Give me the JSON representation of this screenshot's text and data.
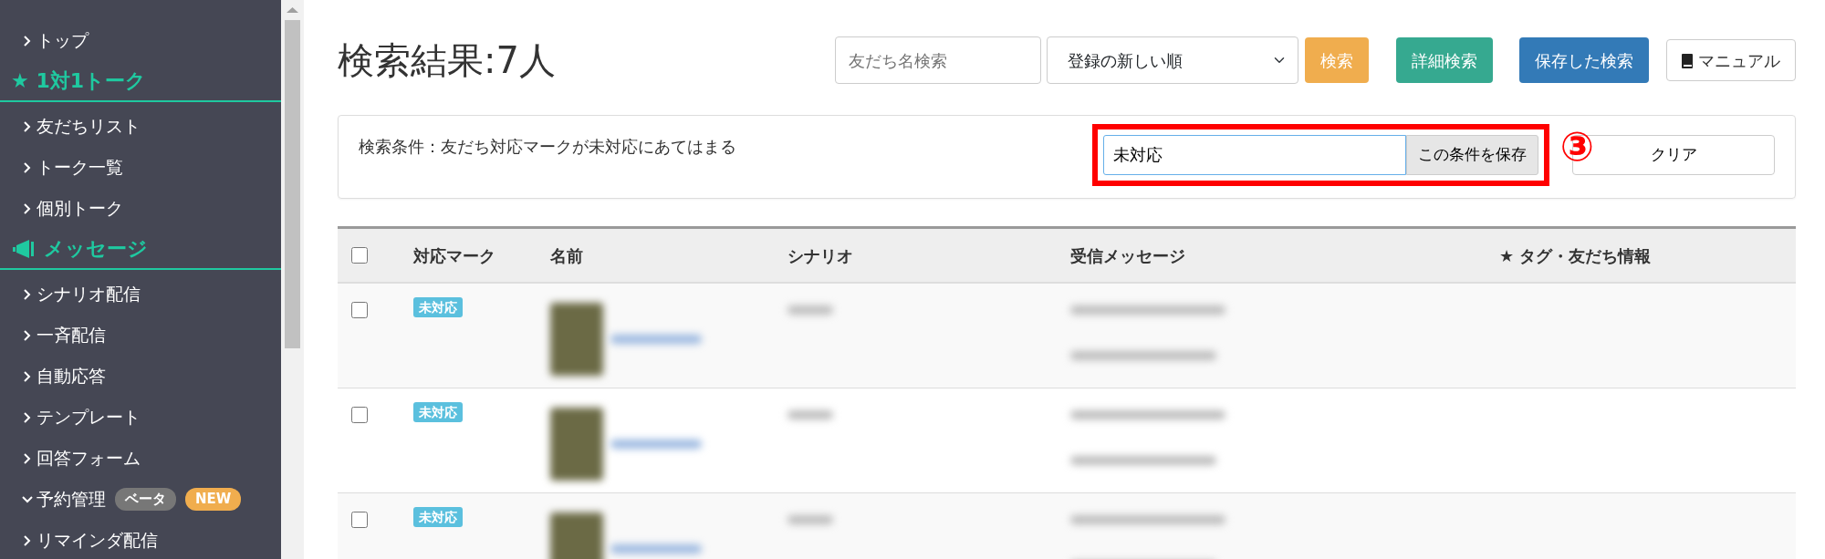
{
  "sidebar": {
    "items": [
      {
        "kind": "link",
        "label": "トップ",
        "expanded": false
      },
      {
        "kind": "heading",
        "label": "★ 1対1トーク"
      },
      {
        "kind": "link",
        "label": "友だちリスト",
        "expanded": false
      },
      {
        "kind": "link",
        "label": "トーク一覧",
        "expanded": false
      },
      {
        "kind": "link",
        "label": "個別トーク",
        "expanded": false
      },
      {
        "kind": "heading",
        "label": "メッセージ"
      },
      {
        "kind": "link",
        "label": "シナリオ配信",
        "expanded": false
      },
      {
        "kind": "link",
        "label": "一斉配信",
        "expanded": false
      },
      {
        "kind": "link",
        "label": "自動応答",
        "expanded": false
      },
      {
        "kind": "link",
        "label": "テンプレート",
        "expanded": false
      },
      {
        "kind": "link",
        "label": "回答フォーム",
        "expanded": false
      },
      {
        "kind": "link",
        "label": "予約管理",
        "expanded": true,
        "badges": [
          {
            "kind": "beta",
            "text": "ベータ"
          },
          {
            "kind": "new",
            "text": "NEW"
          }
        ]
      },
      {
        "kind": "link",
        "label": "リマインダ配信",
        "expanded": false
      }
    ]
  },
  "header": {
    "title": "検索結果:7人",
    "search": {
      "placeholder": "友だち名検索"
    },
    "sort": {
      "value": "登録の新しい順"
    },
    "buttons": [
      {
        "kind": "warning",
        "label": "検索"
      },
      {
        "kind": "teal",
        "label": "詳細検索"
      },
      {
        "kind": "primary",
        "label": "保存した検索"
      },
      {
        "kind": "manual",
        "label": "マニュアル"
      }
    ]
  },
  "condition": {
    "text": "検索条件：友だち対応マークが未対応にあてはまる",
    "name_field": {
      "value": "未対応"
    },
    "save_button": "この条件を保存",
    "annotation": "③",
    "clear_button": "クリア"
  },
  "table": {
    "columns": [
      "対応マーク",
      "名前",
      "シナリオ",
      "受信メッセージ",
      "★ タグ・友だち情報"
    ],
    "header_checked": false,
    "rows": [
      {
        "checked": false,
        "mark": "未対応"
      },
      {
        "checked": false,
        "mark": "未対応"
      },
      {
        "checked": false,
        "mark": "未対応"
      }
    ]
  }
}
